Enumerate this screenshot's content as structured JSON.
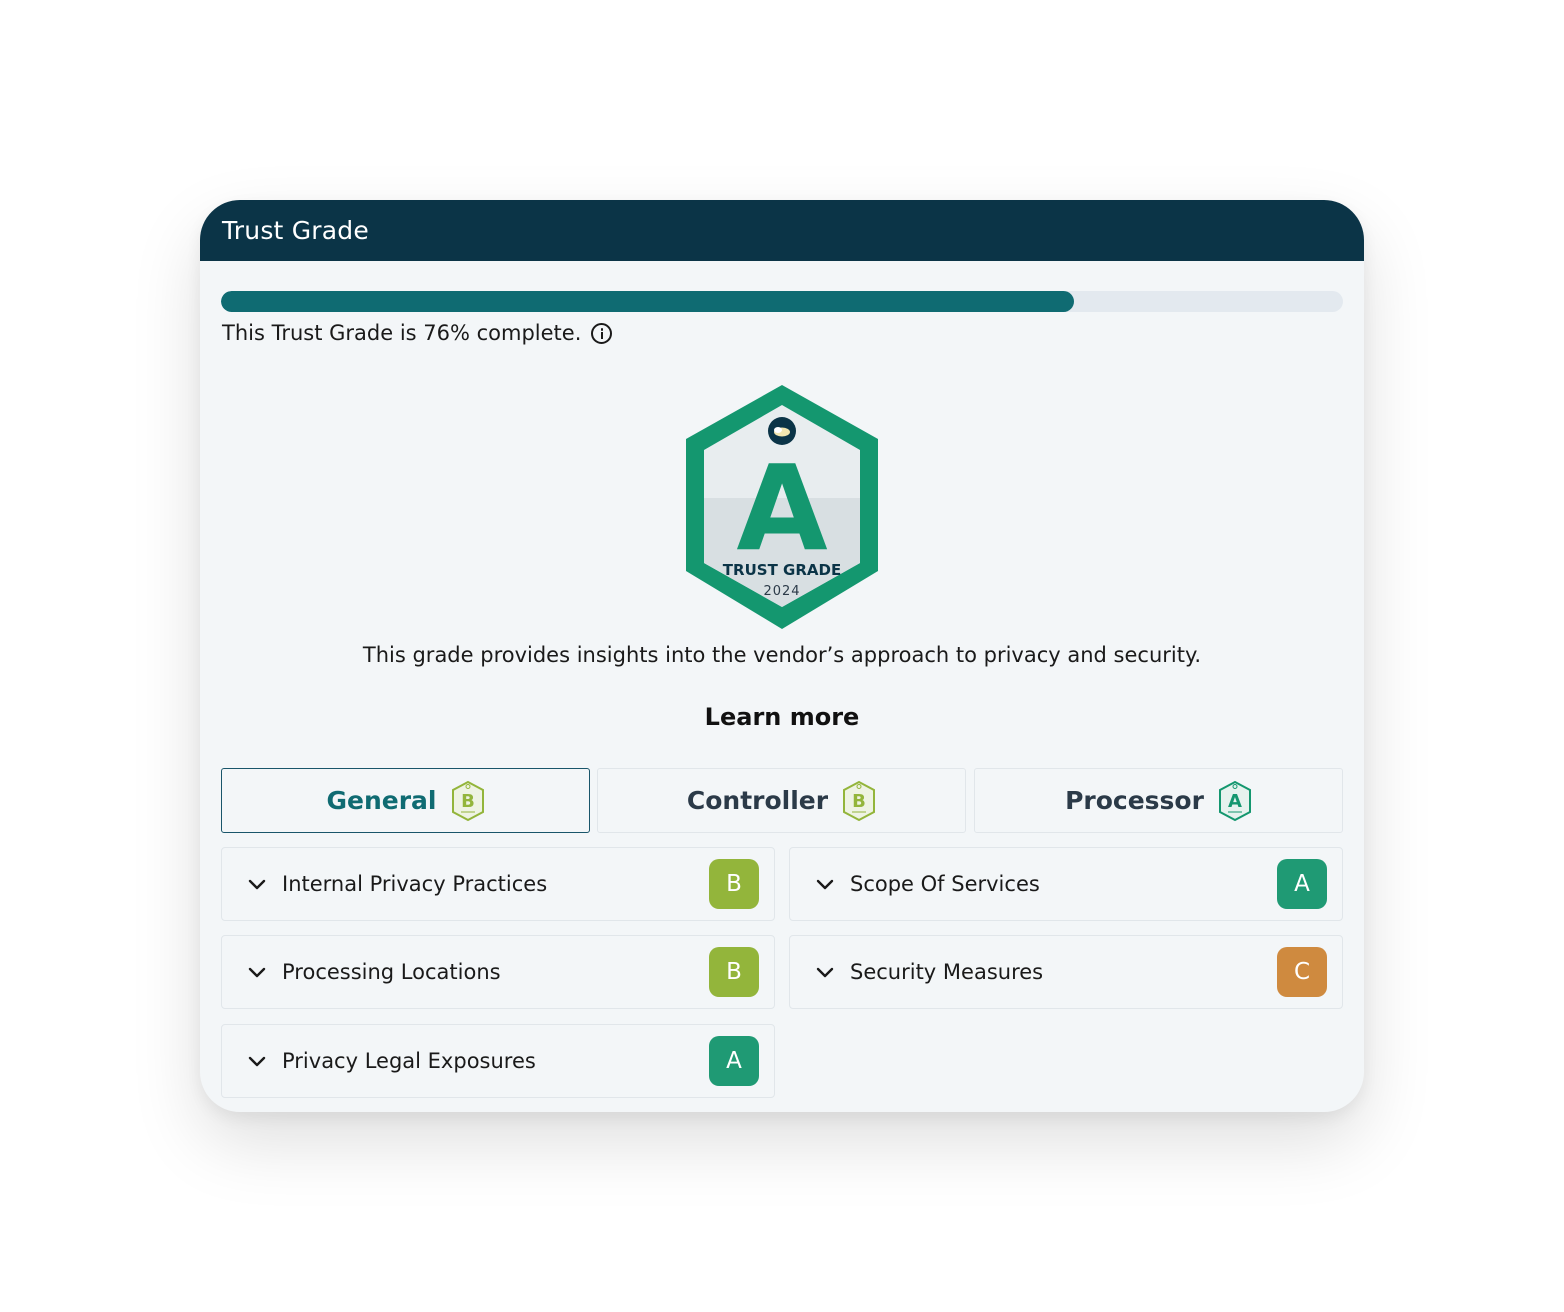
{
  "header": {
    "title": "Trust Grade"
  },
  "progress": {
    "percent": 76,
    "text": "This Trust Grade is 76% complete."
  },
  "badge": {
    "grade": "A",
    "label": "TRUST GRADE",
    "year": "2024"
  },
  "description": "This grade provides insights into the vendor’s approach to privacy and security.",
  "learn_more": "Learn more",
  "tabs": [
    {
      "label": "General",
      "grade": "B",
      "active": true
    },
    {
      "label": "Controller",
      "grade": "B",
      "active": false
    },
    {
      "label": "Processor",
      "grade": "A",
      "active": false
    }
  ],
  "sections": [
    {
      "label": "Internal Privacy Practices",
      "grade": "B"
    },
    {
      "label": "Scope Of Services",
      "grade": "A"
    },
    {
      "label": "Processing Locations",
      "grade": "B"
    },
    {
      "label": "Security Measures",
      "grade": "C"
    },
    {
      "label": "Privacy Legal Exposures",
      "grade": "A"
    }
  ],
  "colors": {
    "header_bg": "#0b3447",
    "progress_fill": "#0f6b72",
    "grade_A": "#1f9a74",
    "grade_B": "#93b53b",
    "grade_C": "#cf8a3f",
    "badge_green": "#14976f"
  },
  "icons": {
    "info": "info-circle-icon",
    "chevron": "chevron-down-icon",
    "badge": "hexagon-shield-badge-icon"
  }
}
